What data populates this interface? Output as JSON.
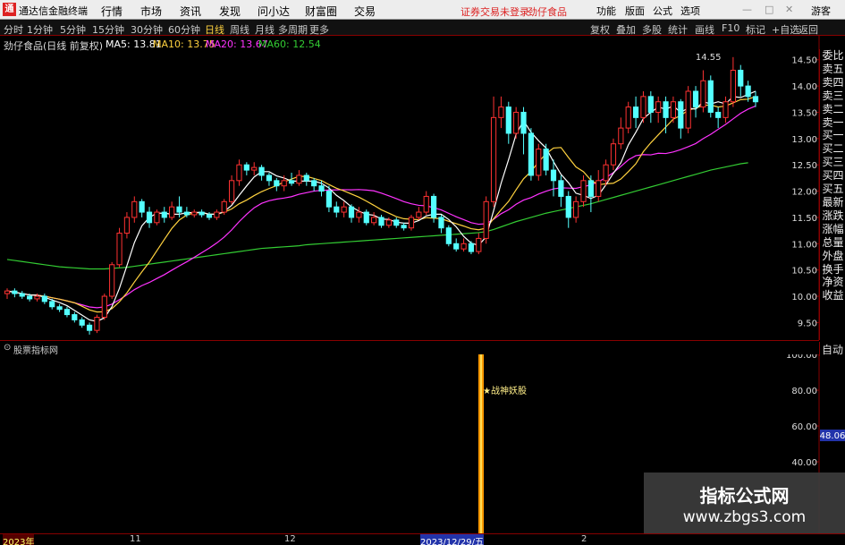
{
  "window": {
    "title": "通达信金融终端",
    "menu": [
      "行情",
      "市场",
      "资讯",
      "发现",
      "问小达",
      "财富圈",
      "交易"
    ],
    "notice": "证券交易未登录",
    "stock": "劲仔食品",
    "right_buttons": [
      "功能",
      "版面",
      "公式",
      "选项",
      "游客"
    ]
  },
  "toolbar": {
    "periods": [
      "分时",
      "1分钟",
      "5分钟",
      "15分钟",
      "30分钟",
      "60分钟",
      "日线",
      "周线",
      "月线",
      "多周期",
      "更多"
    ],
    "active_period": "日线",
    "right": [
      "复权",
      "叠加",
      "多股",
      "统计",
      "画线",
      "F10",
      "标记",
      "+自选",
      "返回"
    ]
  },
  "ma_line": {
    "stock": "劲仔食品(日线 前复权)",
    "ma5": "MA5: 13.81",
    "ma10": "MA10: 13.75",
    "ma20": "MA20: 13.67",
    "ma60": "MA60: 12.54"
  },
  "colors": {
    "up": "#ff3232",
    "down": "#54ffff",
    "ma5": "#ffffff",
    "ma10": "#ffd23f",
    "ma20": "#ff33ff",
    "ma60": "#33cc33",
    "signal": "#ff9900"
  },
  "right_panel": [
    "委比",
    "卖五",
    "卖四",
    "卖三",
    "卖二",
    "卖一",
    "买一",
    "买二",
    "买三",
    "买四",
    "买五",
    "最新",
    "涨跌",
    "涨幅",
    "总量",
    "外盘",
    "换手",
    "净资",
    "收益"
  ],
  "chart_data": {
    "type": "candlestick",
    "ylim": [
      9.2,
      14.7
    ],
    "yticks": [
      "14.50",
      "14.00",
      "13.50",
      "13.00",
      "12.50",
      "12.00",
      "11.50",
      "11.00",
      "10.50",
      "10.00",
      "9.50"
    ],
    "candles": [
      [
        10.05,
        10.1,
        9.95,
        10.15
      ],
      [
        10.1,
        10.05,
        9.98,
        10.15
      ],
      [
        10.05,
        10.0,
        9.95,
        10.1
      ],
      [
        10.0,
        9.95,
        9.9,
        10.05
      ],
      [
        9.95,
        10.0,
        9.9,
        10.05
      ],
      [
        10.0,
        9.9,
        9.85,
        10.05
      ],
      [
        9.9,
        9.8,
        9.75,
        9.95
      ],
      [
        9.8,
        9.75,
        9.7,
        9.85
      ],
      [
        9.75,
        9.65,
        9.6,
        9.8
      ],
      [
        9.65,
        9.55,
        9.5,
        9.7
      ],
      [
        9.55,
        9.45,
        9.4,
        9.6
      ],
      [
        9.45,
        9.35,
        9.27,
        9.5
      ],
      [
        9.35,
        9.6,
        9.3,
        9.65
      ],
      [
        9.6,
        10.0,
        9.55,
        10.05
      ],
      [
        10.0,
        10.6,
        9.95,
        10.65
      ],
      [
        10.6,
        11.2,
        10.55,
        11.3
      ],
      [
        11.2,
        11.5,
        11.1,
        11.6
      ],
      [
        11.5,
        11.8,
        11.4,
        11.9
      ],
      [
        11.8,
        11.6,
        11.5,
        11.85
      ],
      [
        11.6,
        11.4,
        11.3,
        11.7
      ],
      [
        11.4,
        11.6,
        11.35,
        11.65
      ],
      [
        11.6,
        11.5,
        11.4,
        11.7
      ],
      [
        11.5,
        11.7,
        11.45,
        11.8
      ],
      [
        11.7,
        11.6,
        11.5,
        11.9
      ],
      [
        11.6,
        11.55,
        11.5,
        11.7
      ],
      [
        11.55,
        11.6,
        11.5,
        11.65
      ],
      [
        11.6,
        11.55,
        11.5,
        11.65
      ],
      [
        11.55,
        11.5,
        11.45,
        11.6
      ],
      [
        11.5,
        11.6,
        11.45,
        11.65
      ],
      [
        11.6,
        11.8,
        11.55,
        11.85
      ],
      [
        11.8,
        12.2,
        11.75,
        12.3
      ],
      [
        12.2,
        12.5,
        12.1,
        12.6
      ],
      [
        12.5,
        12.4,
        12.3,
        12.55
      ],
      [
        12.4,
        12.45,
        12.3,
        12.55
      ],
      [
        12.45,
        12.3,
        12.2,
        12.5
      ],
      [
        12.3,
        12.2,
        12.1,
        12.35
      ],
      [
        12.2,
        12.1,
        12.0,
        12.25
      ],
      [
        12.1,
        12.2,
        12.0,
        12.3
      ],
      [
        12.2,
        12.15,
        12.1,
        12.35
      ],
      [
        12.15,
        12.3,
        12.1,
        12.4
      ],
      [
        12.3,
        12.2,
        12.1,
        12.35
      ],
      [
        12.2,
        12.1,
        12.0,
        12.25
      ],
      [
        12.1,
        12.0,
        11.9,
        12.2
      ],
      [
        12.0,
        11.7,
        11.6,
        12.1
      ],
      [
        11.7,
        11.6,
        11.5,
        11.8
      ],
      [
        11.6,
        11.7,
        11.5,
        11.8
      ],
      [
        11.7,
        11.5,
        11.4,
        11.75
      ],
      [
        11.5,
        11.6,
        11.4,
        11.7
      ],
      [
        11.6,
        11.4,
        11.35,
        11.65
      ],
      [
        11.4,
        11.5,
        11.35,
        11.6
      ],
      [
        11.5,
        11.35,
        11.3,
        11.55
      ],
      [
        11.35,
        11.45,
        11.3,
        11.5
      ],
      [
        11.45,
        11.35,
        11.3,
        11.5
      ],
      [
        11.35,
        11.3,
        11.25,
        11.4
      ],
      [
        11.3,
        11.5,
        11.25,
        11.55
      ],
      [
        11.5,
        11.6,
        11.45,
        11.7
      ],
      [
        11.6,
        11.9,
        11.55,
        12.0
      ],
      [
        11.9,
        11.5,
        11.4,
        11.95
      ],
      [
        11.5,
        11.3,
        11.2,
        11.55
      ],
      [
        11.3,
        11.0,
        10.95,
        11.35
      ],
      [
        11.0,
        10.9,
        10.85,
        11.1
      ],
      [
        10.9,
        11.0,
        10.85,
        11.1
      ],
      [
        11.0,
        10.85,
        10.8,
        11.05
      ],
      [
        10.85,
        11.1,
        10.8,
        11.2
      ],
      [
        11.1,
        11.8,
        11.0,
        11.9
      ],
      [
        11.8,
        13.4,
        11.7,
        13.8
      ],
      [
        13.4,
        13.6,
        13.2,
        13.8
      ],
      [
        13.6,
        13.1,
        12.9,
        13.7
      ],
      [
        13.1,
        13.5,
        13.0,
        13.6
      ],
      [
        13.5,
        13.1,
        12.7,
        13.6
      ],
      [
        13.1,
        12.3,
        12.2,
        13.2
      ],
      [
        12.3,
        12.8,
        12.2,
        12.9
      ],
      [
        12.8,
        12.4,
        12.3,
        12.9
      ],
      [
        12.4,
        12.2,
        11.9,
        12.6
      ],
      [
        12.2,
        11.9,
        11.7,
        12.3
      ],
      [
        11.9,
        11.5,
        11.3,
        12.0
      ],
      [
        11.5,
        11.8,
        11.4,
        11.9
      ],
      [
        11.8,
        12.2,
        11.7,
        12.3
      ],
      [
        12.2,
        11.9,
        11.6,
        12.3
      ],
      [
        11.9,
        12.2,
        11.8,
        12.4
      ],
      [
        12.2,
        12.5,
        12.1,
        12.6
      ],
      [
        12.5,
        12.9,
        12.4,
        13.0
      ],
      [
        12.9,
        13.2,
        12.8,
        13.4
      ],
      [
        13.2,
        13.6,
        13.1,
        13.7
      ],
      [
        13.6,
        13.4,
        13.2,
        13.8
      ],
      [
        13.4,
        13.8,
        13.3,
        13.9
      ],
      [
        13.8,
        13.5,
        13.3,
        13.9
      ],
      [
        13.5,
        13.7,
        13.3,
        13.8
      ],
      [
        13.7,
        13.4,
        13.1,
        13.8
      ],
      [
        13.4,
        13.7,
        13.3,
        13.8
      ],
      [
        13.7,
        13.2,
        13.0,
        13.75
      ],
      [
        13.2,
        13.9,
        13.1,
        14.0
      ],
      [
        13.9,
        13.6,
        13.4,
        14.0
      ],
      [
        13.6,
        14.1,
        13.5,
        14.3
      ],
      [
        14.1,
        13.5,
        13.4,
        14.2
      ],
      [
        13.5,
        13.4,
        13.2,
        13.6
      ],
      [
        13.4,
        13.7,
        13.3,
        13.8
      ],
      [
        13.7,
        14.3,
        13.6,
        14.55
      ],
      [
        14.3,
        14.0,
        13.8,
        14.4
      ],
      [
        14.0,
        13.8,
        13.7,
        14.1
      ],
      [
        13.8,
        13.7,
        13.6,
        13.9
      ]
    ],
    "ma60": [
      10.7,
      10.68,
      10.66,
      10.64,
      10.62,
      10.6,
      10.58,
      10.56,
      10.55,
      10.54,
      10.53,
      10.52,
      10.52,
      10.52,
      10.53,
      10.54,
      10.55,
      10.57,
      10.59,
      10.61,
      10.63,
      10.65,
      10.67,
      10.69,
      10.71,
      10.73,
      10.75,
      10.77,
      10.79,
      10.81,
      10.83,
      10.85,
      10.87,
      10.89,
      10.91,
      10.92,
      10.93,
      10.94,
      10.95,
      10.96,
      10.98,
      10.99,
      11.0,
      11.01,
      11.02,
      11.03,
      11.04,
      11.05,
      11.06,
      11.07,
      11.08,
      11.09,
      11.1,
      11.11,
      11.12,
      11.13,
      11.14,
      11.15,
      11.16,
      11.17,
      11.18,
      11.19,
      11.2,
      11.21,
      11.23,
      11.27,
      11.32,
      11.37,
      11.42,
      11.46,
      11.5,
      11.54,
      11.58,
      11.61,
      11.64,
      11.67,
      11.7,
      11.73,
      11.76,
      11.8,
      11.84,
      11.88,
      11.92,
      11.96,
      12.0,
      12.04,
      12.08,
      12.12,
      12.16,
      12.2,
      12.24,
      12.28,
      12.32,
      12.36,
      12.4,
      12.43,
      12.46,
      12.49,
      12.52,
      12.54
    ],
    "price_high": "14.55",
    "price_low": "9.27"
  },
  "sub_chart": {
    "name": "股票指标网",
    "label": "战神妖股",
    "value_label": "48.06",
    "yticks": [
      "100.00",
      "80.00",
      "60.00",
      "40.00"
    ],
    "signal_value": 100
  },
  "date_axis": [
    "2023年",
    "11",
    "12",
    "2023/12/29/五",
    "2"
  ],
  "watermark": {
    "title": "指标公式网",
    "url": "www.zbgs3.com"
  }
}
